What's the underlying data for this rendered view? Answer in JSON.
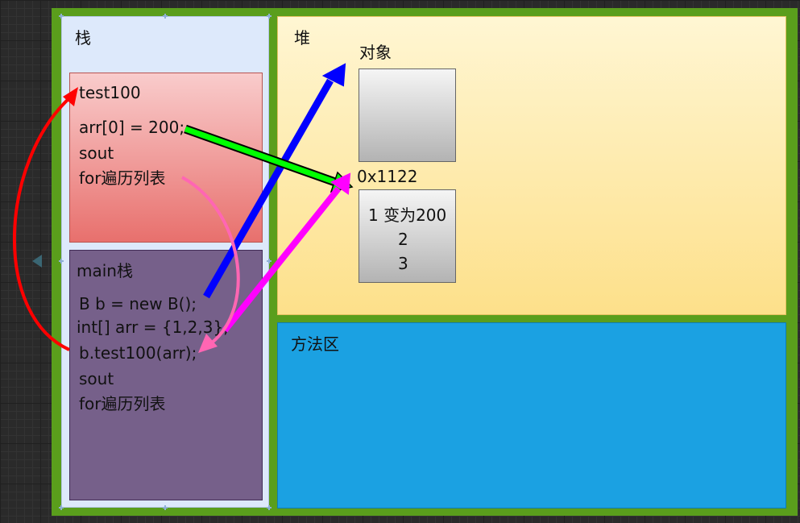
{
  "regions": {
    "stack": "栈",
    "heap": "堆",
    "method_area": "方法区"
  },
  "test100_frame": {
    "title": "test100",
    "line1": "arr[0] = 200;",
    "line2": "sout",
    "line3": "for遍历列表"
  },
  "main_frame": {
    "title": "main栈",
    "line1": "B b = new B();",
    "line2": "int[] arr = {1,2,3};",
    "line3": "b.test100(arr);",
    "line4": "sout",
    "line5": "for遍历列表"
  },
  "heap": {
    "object_label": "对象",
    "array_address": "0x1122",
    "array_values": [
      "1 变为200",
      "2",
      "3"
    ]
  },
  "colors": {
    "container_border": "#5a9e1c",
    "stack_bg": "#dde9fb",
    "heap_bg": "#fde08a",
    "method_area_bg": "#1ba1e2",
    "test100_frame_bg": "#e8706d",
    "main_frame_bg": "#76608a",
    "arrow_call_return": "#ff0000",
    "arrow_new_object": "#0000ff",
    "arrow_write_element": "#00ff00",
    "arrow_array_ref": "#ff00ff",
    "arrow_return_to_main": "#ff66b3"
  }
}
